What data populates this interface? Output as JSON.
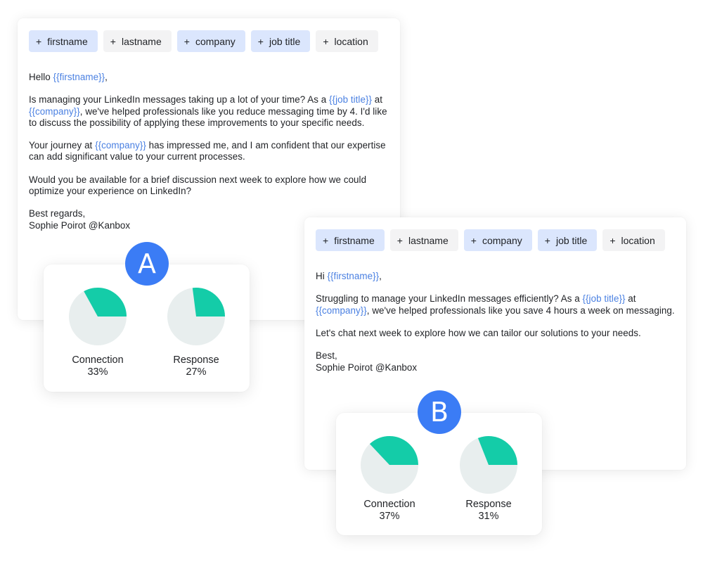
{
  "colors": {
    "chip_blue": "#dbe6fd",
    "chip_grey": "#f3f3f4",
    "variable_text": "#4a80e2",
    "badge": "#3b7cf5",
    "pie_fill": "#14cca8",
    "pie_rest": "#e8eeee"
  },
  "variant_a": {
    "chips": [
      {
        "label": "firstname",
        "style": "blue",
        "icon": "plus-icon"
      },
      {
        "label": "lastname",
        "style": "grey",
        "icon": "plus-icon"
      },
      {
        "label": "company",
        "style": "blue",
        "icon": "plus-icon"
      },
      {
        "label": "job title",
        "style": "blue",
        "icon": "plus-icon"
      },
      {
        "label": "location",
        "style": "grey",
        "icon": "plus-icon"
      }
    ],
    "message": {
      "greeting_prefix": "Hello ",
      "greeting_var": "{{firstname}}",
      "greeting_suffix": ",",
      "p1_a": "Is managing your LinkedIn messages taking up a lot of your time? As a ",
      "p1_var1": "{{job title}}",
      "p1_b": " at ",
      "p1_var2": "{{company}}",
      "p1_c": ", we've helped professionals like you reduce messaging time by 4. I'd like to discuss the possibility of applying these improvements to your specific needs.",
      "p2_a": "Your journey at ",
      "p2_var": "{{company}}",
      "p2_b": " has impressed me, and I am confident that our expertise can add significant value to your current processes.",
      "p3": "Would you be available for a brief discussion next week to explore how we could optimize your experience on LinkedIn?",
      "signoff": "Best regards,",
      "signature": "Sophie Poirot @Kanbox"
    },
    "badge": "A",
    "stats": [
      {
        "label": "Connection",
        "value_text": "33%",
        "value": 33
      },
      {
        "label": "Response",
        "value_text": "27%",
        "value": 27
      }
    ]
  },
  "variant_b": {
    "chips": [
      {
        "label": "firstname",
        "style": "blue",
        "icon": "plus-icon"
      },
      {
        "label": "lastname",
        "style": "grey",
        "icon": "plus-icon"
      },
      {
        "label": "company",
        "style": "blue",
        "icon": "plus-icon"
      },
      {
        "label": "job title",
        "style": "blue",
        "icon": "plus-icon"
      },
      {
        "label": "location",
        "style": "grey",
        "icon": "plus-icon"
      }
    ],
    "message": {
      "greeting_prefix": "Hi ",
      "greeting_var": "{{firstname}}",
      "greeting_suffix": ",",
      "p1_a": "Struggling to manage your LinkedIn messages efficiently? As a ",
      "p1_var1": "{{job title}}",
      "p1_b": " at ",
      "p1_var2": "{{company}}",
      "p1_c": ", we've helped professionals like you save 4 hours a week on messaging.",
      "p2": "Let's chat next week to explore how we can tailor our solutions to your needs.",
      "signoff": "Best,",
      "signature": "Sophie Poirot @Kanbox"
    },
    "badge": "B",
    "stats": [
      {
        "label": "Connection",
        "value_text": "37%",
        "value": 37
      },
      {
        "label": "Response",
        "value_text": "31%",
        "value": 31
      }
    ]
  },
  "chip_plus_symbol": "+"
}
